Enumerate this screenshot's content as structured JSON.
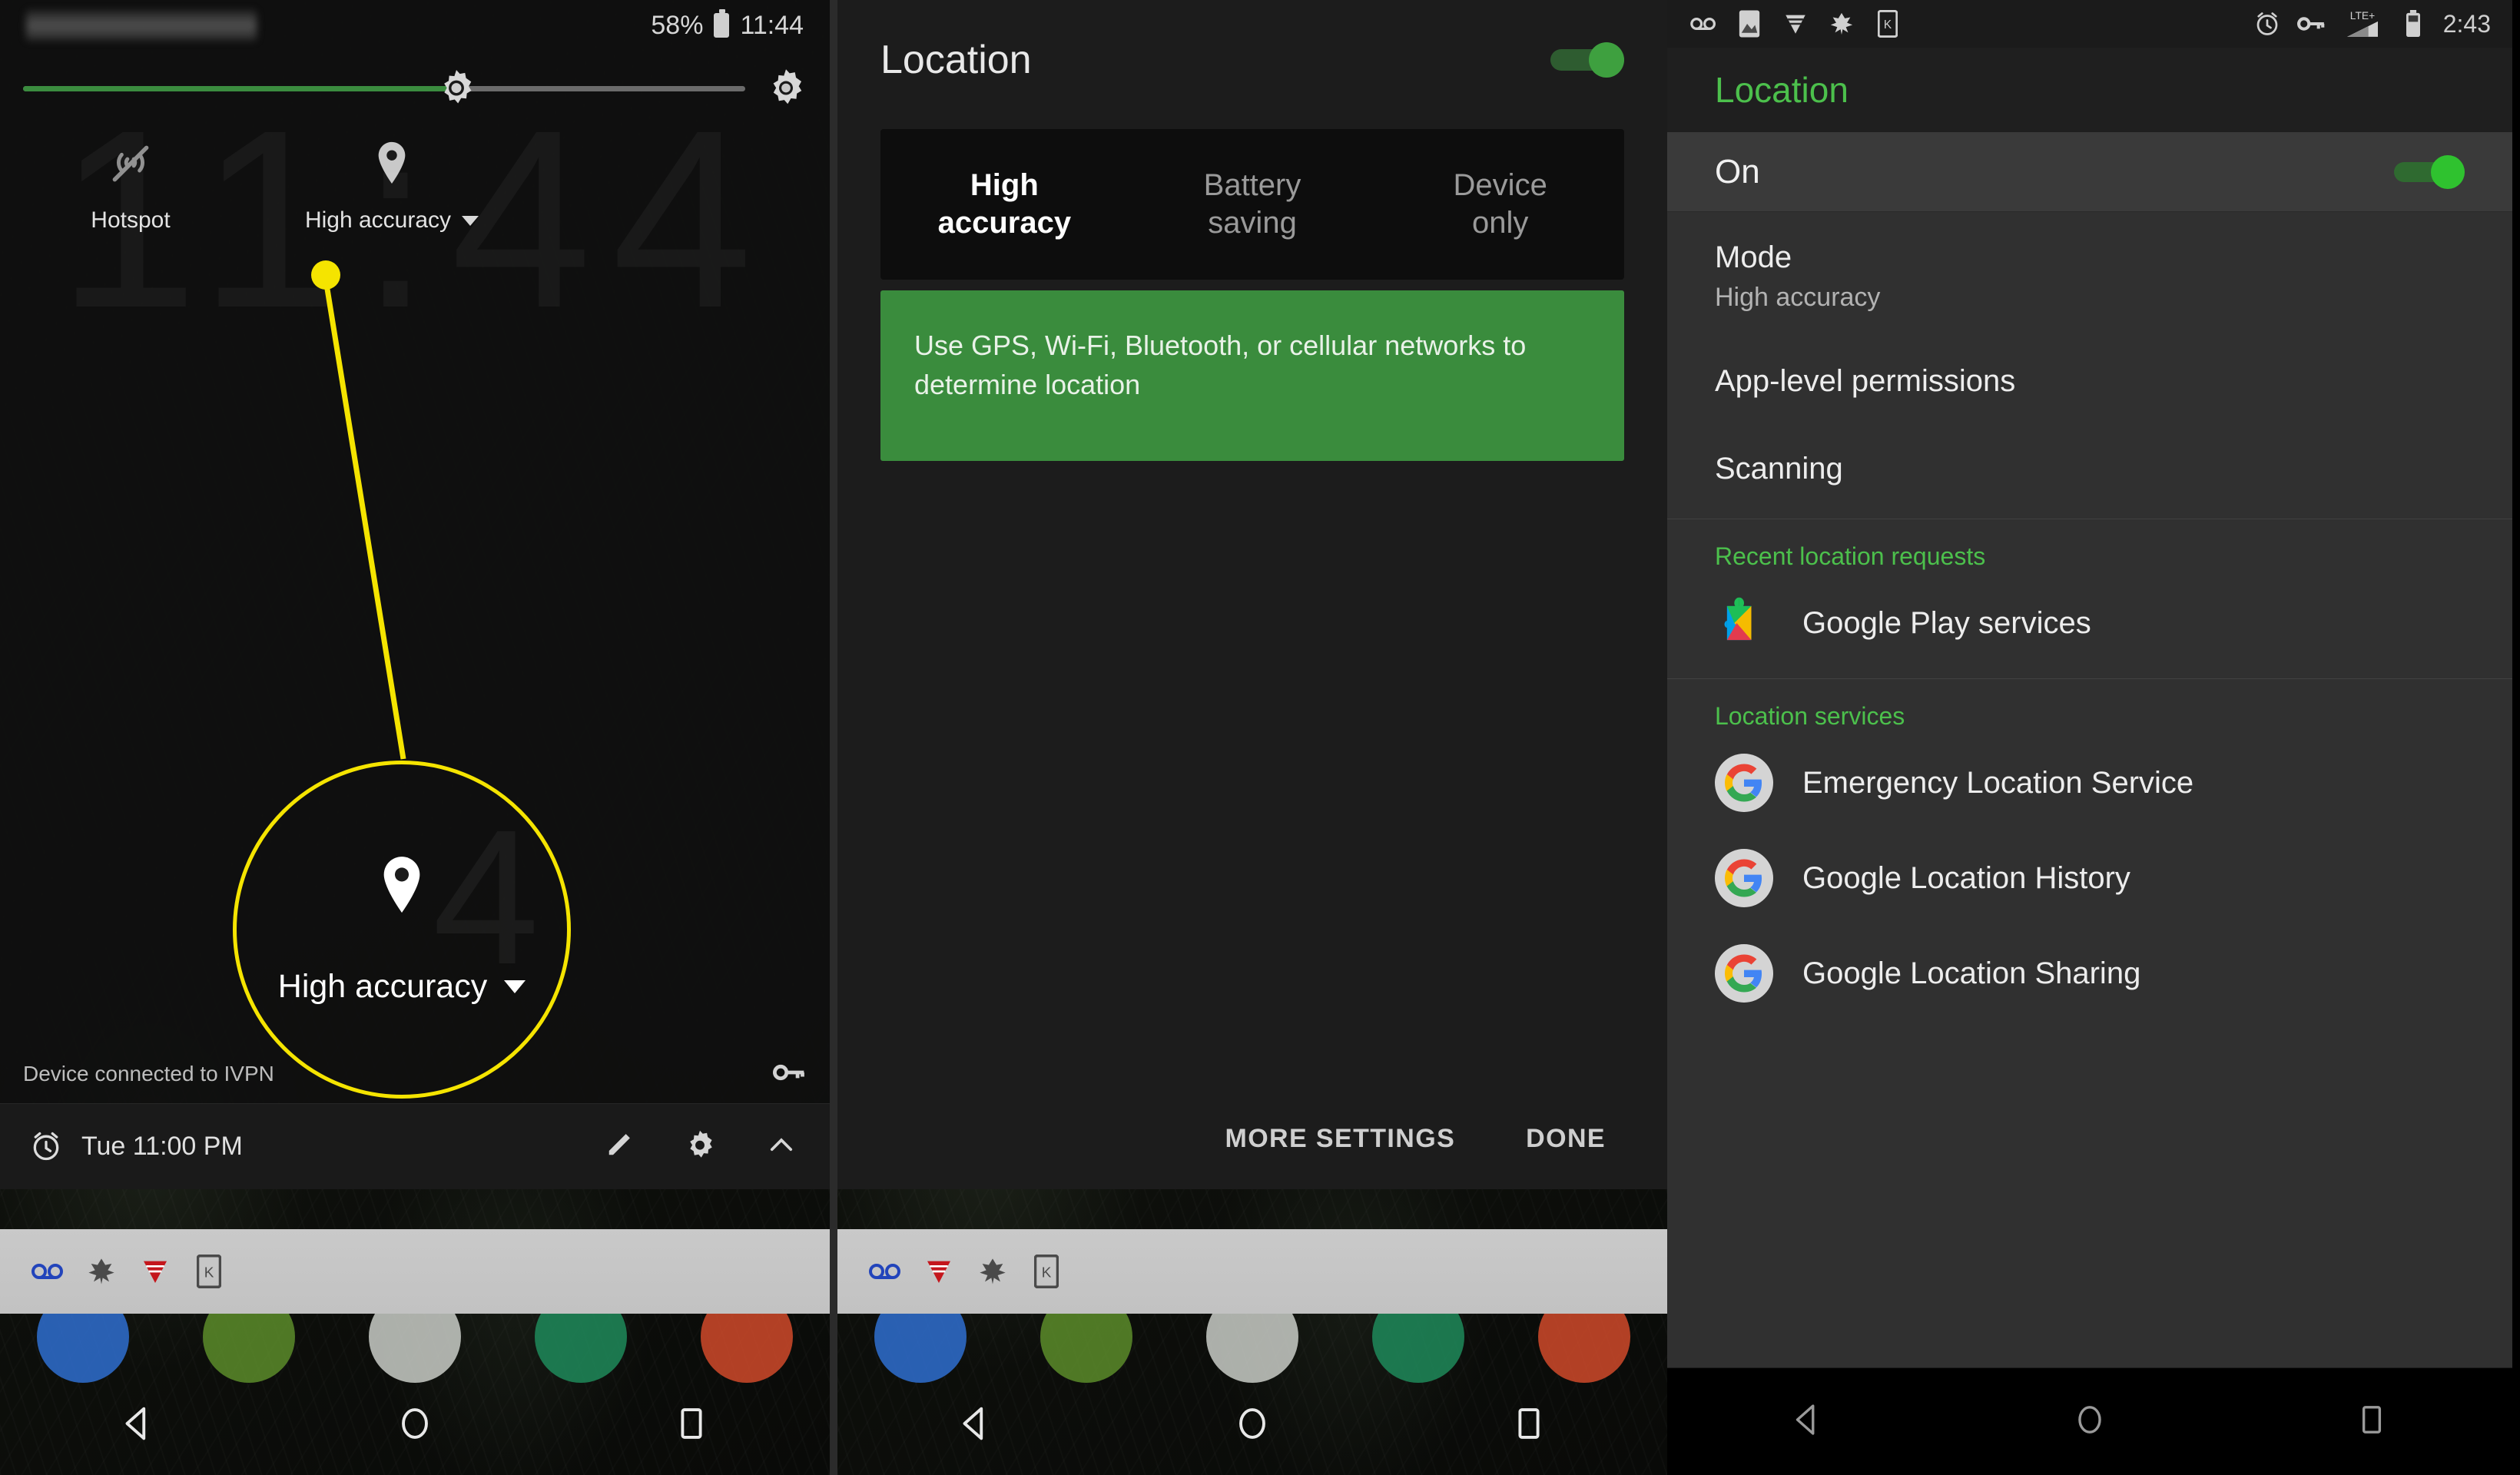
{
  "panel1": {
    "status_bar": {
      "redacted_label": "",
      "battery_percent": "58%",
      "time": "11:44",
      "battery_icon": "battery-icon"
    },
    "brightness": {
      "icon": "brightness-sun-icon",
      "settings_icon": "settings-gear-icon",
      "level_percent": 60
    },
    "tiles": [
      {
        "icon": "hotspot-off-icon",
        "label": "Hotspot",
        "has_caret": false
      },
      {
        "icon": "location-pin-icon",
        "label": "High accuracy",
        "has_caret": true
      }
    ],
    "callout": {
      "icon": "location-pin-icon",
      "label": "High accuracy",
      "highlight_color": "#f5e400"
    },
    "vpn_row": {
      "text": "Device connected to IVPN",
      "icon": "vpn-key-icon"
    },
    "alarm_bar": {
      "icon": "alarm-clock-icon",
      "text": "Tue 11:00 PM",
      "edit_icon": "pencil-icon",
      "settings_icon": "gear-icon",
      "collapse_icon": "chevron-up-icon"
    },
    "notification_icons": [
      "voicemail-icon",
      "leaf-icon",
      "v-logo-icon",
      "kindle-icon"
    ],
    "nav_bar": [
      "back-icon",
      "home-icon",
      "recents-icon"
    ]
  },
  "panel2": {
    "title": "Location",
    "master_toggle": {
      "state": "on",
      "color": "#3ea03f"
    },
    "modes": [
      {
        "line1": "High",
        "line2": "accuracy",
        "selected": true
      },
      {
        "line1": "Battery",
        "line2": "saving",
        "selected": false
      },
      {
        "line1": "Device",
        "line2": "only",
        "selected": false
      }
    ],
    "description": "Use GPS, Wi-Fi, Bluetooth, or cellular networks to determine location",
    "description_bg": "#3a8c3d",
    "actions": {
      "more": "MORE SETTINGS",
      "done": "DONE"
    },
    "notification_icons": [
      "voicemail-icon",
      "v-logo-icon",
      "leaf-icon",
      "kindle-icon"
    ],
    "nav_bar": [
      "back-icon",
      "home-icon",
      "recents-icon"
    ]
  },
  "panel3": {
    "status_bar": {
      "left_icons": [
        "voicemail-icon",
        "photos-icon",
        "v-logo-icon",
        "leaf-icon",
        "kindle-icon"
      ],
      "right_icons": [
        "alarm-clock-icon",
        "vpn-key-icon",
        "lte-signal-icon",
        "battery-icon"
      ],
      "network_label": "LTE+",
      "time": "2:43"
    },
    "app_bar": {
      "title": "Location",
      "title_color": "#4cc04c"
    },
    "master": {
      "label": "On",
      "toggle_state": "on",
      "toggle_color": "#2fc22f"
    },
    "prefs": [
      {
        "title": "Mode",
        "summary": "High accuracy"
      },
      {
        "title": "App-level permissions",
        "summary": ""
      },
      {
        "title": "Scanning",
        "summary": ""
      }
    ],
    "sections": [
      {
        "header": "Recent location requests",
        "items": [
          {
            "icon": "google-play-services-icon",
            "name": "Google Play services"
          }
        ]
      },
      {
        "header": "Location services",
        "items": [
          {
            "icon": "google-g-icon",
            "name": "Emergency Location Service"
          },
          {
            "icon": "google-g-icon",
            "name": "Google Location History"
          },
          {
            "icon": "google-g-icon",
            "name": "Google Location Sharing"
          }
        ]
      }
    ],
    "nav_bar": [
      "back-icon",
      "home-icon",
      "recents-icon"
    ]
  }
}
